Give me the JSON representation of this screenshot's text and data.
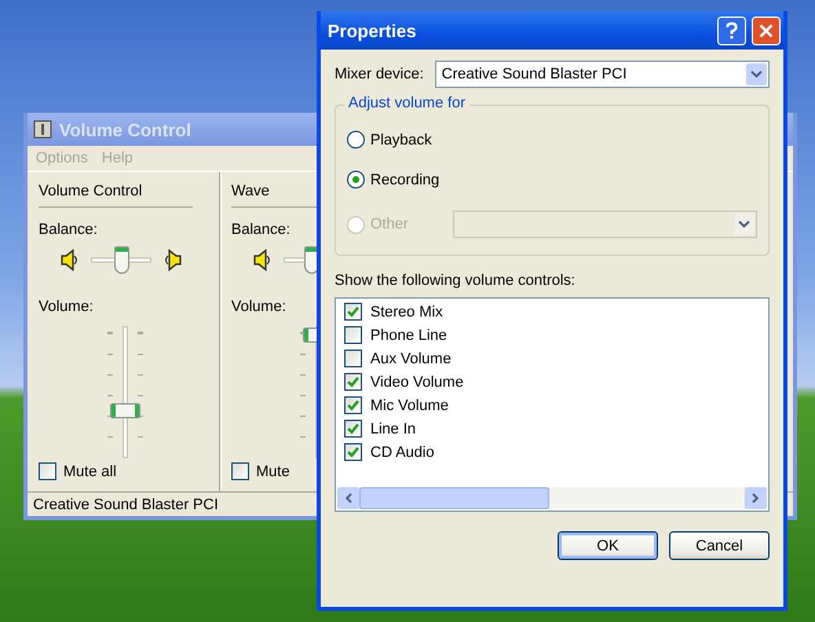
{
  "volume_window": {
    "title": "Volume Control",
    "menu": [
      {
        "label": "Options"
      },
      {
        "label": "Help"
      }
    ],
    "channels": [
      {
        "name": "Volume Control",
        "balance_label": "Balance:",
        "balance": {
          "level": 0.5
        },
        "volume_label": "Volume:",
        "volume": {
          "level": 0.35
        },
        "mute": {
          "label": "Mute all",
          "checked": false
        }
      },
      {
        "name": "Wave",
        "balance_label": "Balance:",
        "balance": {
          "level": 0.45
        },
        "volume_label": "Volume:",
        "volume": {
          "level": 1.0
        },
        "mute": {
          "label": "Mute",
          "checked": false
        }
      }
    ],
    "status_bar": "Creative Sound Blaster PCI"
  },
  "properties": {
    "title": "Properties",
    "mixer_label": "Mixer device:",
    "mixer_value": "Creative Sound Blaster PCI",
    "group_title": "Adjust volume for",
    "options": [
      {
        "label": "Playback",
        "selected": false,
        "disabled": false
      },
      {
        "label": "Recording",
        "selected": true,
        "disabled": false
      },
      {
        "label": "Other",
        "selected": false,
        "disabled": true
      }
    ],
    "list_label": "Show the following volume controls:",
    "controls": [
      {
        "label": "Stereo Mix",
        "checked": true
      },
      {
        "label": "Phone Line",
        "checked": false
      },
      {
        "label": "Aux Volume",
        "checked": false
      },
      {
        "label": "Video Volume",
        "checked": true
      },
      {
        "label": "Mic Volume",
        "checked": true
      },
      {
        "label": "Line In",
        "checked": true
      },
      {
        "label": "CD Audio",
        "checked": true
      }
    ],
    "buttons": [
      {
        "label": "OK",
        "default": true
      },
      {
        "label": "Cancel",
        "default": false
      }
    ]
  }
}
